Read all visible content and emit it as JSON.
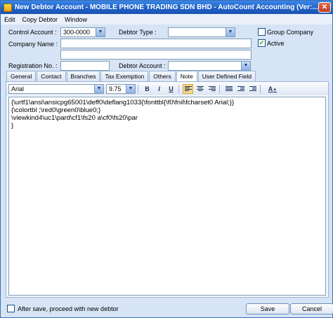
{
  "window": {
    "title": "New Debtor Account - MOBILE PHONE TRADING SDN BHD - AutoCount Accounting (Ver:...",
    "close_glyph": "✕"
  },
  "menu": [
    "Edit",
    "Copy Debtor",
    "Window"
  ],
  "form": {
    "control_account_label": "Control Account :",
    "control_account_value": "300-0000",
    "debtor_type_label": "Debtor Type :",
    "debtor_type_value": "",
    "company_name_label": "Company Name :",
    "company_name_value": "",
    "company_name2_value": "",
    "registration_label": "Registration No. :",
    "registration_value": "",
    "debtor_account_label": "Debtor Account :",
    "debtor_account_value": "",
    "group_company_label": "Group Company",
    "group_company_checked": false,
    "active_label": "Active",
    "active_checked": true
  },
  "tabs": [
    "General",
    "Contact",
    "Branches",
    "Tax Exemption",
    "Others",
    "Note",
    "User Defined Field"
  ],
  "active_tab": "Note",
  "toolbar": {
    "font_name": "Arial",
    "font_size": "9.75",
    "bold": "B",
    "italic": "I",
    "underline": "U",
    "text_color_glyph": "A"
  },
  "note_text": "{\\urtf1\\ansi\\ansicpg65001\\deff0\\deflang1033{\\fonttbl{\\f0\\fnil\\fcharset0 Arial;}}\n{\\colortbl ;\\red0\\green0\\blue0;}\n\\viewkind4\\uc1\\pard\\cf1\\fs20 a\\cf0\\fs20\\par\n}",
  "footer": {
    "proceed_label": "After save, proceed with new debtor",
    "proceed_checked": false,
    "save_label": "Save",
    "cancel_label": "Cancel"
  },
  "icons": {
    "check_glyph": "✓",
    "dropdown_glyph": "▼"
  }
}
